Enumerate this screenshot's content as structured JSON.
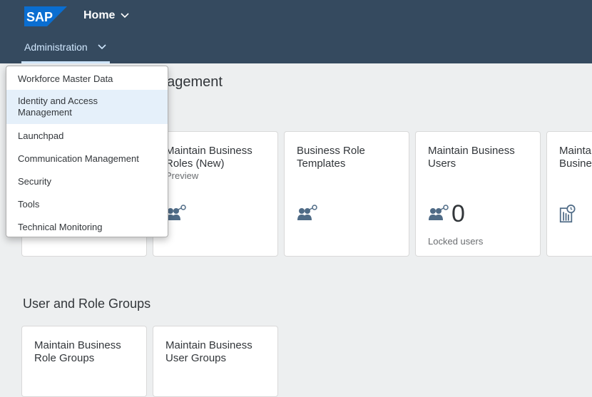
{
  "header": {
    "logo_text": "SAP",
    "home_label": "Home",
    "subnav_label": "Administration",
    "brand_color": "#354a5f",
    "logo_color": "#0a6ed1"
  },
  "page": {
    "title_visible": "nagement",
    "section_title": "User and Role Groups"
  },
  "menu": {
    "items": [
      {
        "label": "Workforce Master Data"
      },
      {
        "label": "Identity and Access Management",
        "selected": true
      },
      {
        "label": "Launchpad"
      },
      {
        "label": "Communication Management"
      },
      {
        "label": "Security"
      },
      {
        "label": "Tools"
      },
      {
        "label": "Technical Monitoring"
      }
    ]
  },
  "tiles": [
    {
      "title": "Maintain Business Roles (New)",
      "subtitle": "Preview",
      "icon": "business-role-key-icon"
    },
    {
      "title": "Business Role Templates",
      "icon": "business-role-key-icon"
    },
    {
      "title": "Maintain Business Users",
      "number": "0",
      "footer": "Locked users",
      "icon": "business-role-key-icon"
    },
    {
      "title": "Mainta Busine",
      "icon": "building-clock-icon"
    }
  ],
  "group_tiles": [
    {
      "title": "Maintain Business Role Groups"
    },
    {
      "title": "Maintain Business User Groups"
    }
  ]
}
